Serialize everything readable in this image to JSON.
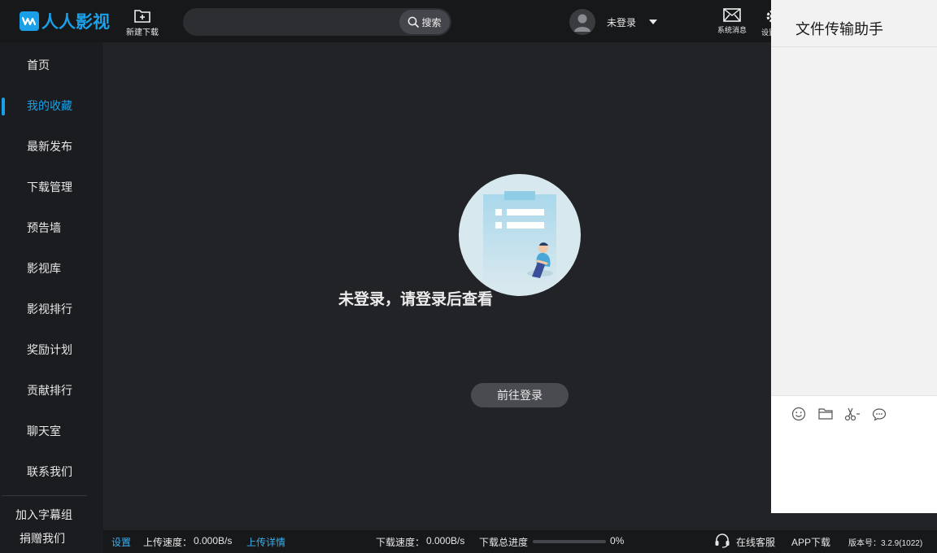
{
  "topbar": {
    "logo_text": "人人影视",
    "new_download_label": "新建下载",
    "search": {
      "value": "",
      "placeholder": "",
      "button_label": "搜索"
    },
    "user_name": "未登录",
    "system_messages_label": "系统消息",
    "settings_label": "设置"
  },
  "sidebar": {
    "items": [
      {
        "label": "首页"
      },
      {
        "label": "我的收藏"
      },
      {
        "label": "最新发布"
      },
      {
        "label": "下载管理"
      },
      {
        "label": "预告墙"
      },
      {
        "label": "影视库"
      },
      {
        "label": "影视排行"
      },
      {
        "label": "奖励计划"
      },
      {
        "label": "贡献排行"
      },
      {
        "label": "聊天室"
      },
      {
        "label": "联系我们"
      }
    ],
    "active_item": "我的收藏",
    "join_subtitle_group": "加入字幕组",
    "donate": "捐赠我们"
  },
  "main": {
    "empty_message": "未登录，请登录后查看",
    "login_button": "前往登录"
  },
  "statusbar": {
    "settings": "设置",
    "upload_speed_label": "上传速度：",
    "upload_speed_value": "0.000B/s",
    "upload_details": "上传详情",
    "download_speed_label": "下载速度：",
    "download_speed_value": "0.000B/s",
    "total_progress_label": "下载总进度",
    "total_progress_value": "0%",
    "total_progress_fraction": 0,
    "online_service": "在线客服",
    "app_download": "APP下载",
    "version": "版本号：3.2.9(1022)"
  },
  "side_panel": {
    "title": "文件传输助手",
    "tools": [
      "emoji-icon",
      "folder-icon",
      "scissors-icon",
      "chat-bubble-icon"
    ]
  },
  "colors": {
    "accent": "#1aa0e8",
    "background": "#222326",
    "topbar": "#17181a",
    "sidebar": "#1b1c1f"
  }
}
